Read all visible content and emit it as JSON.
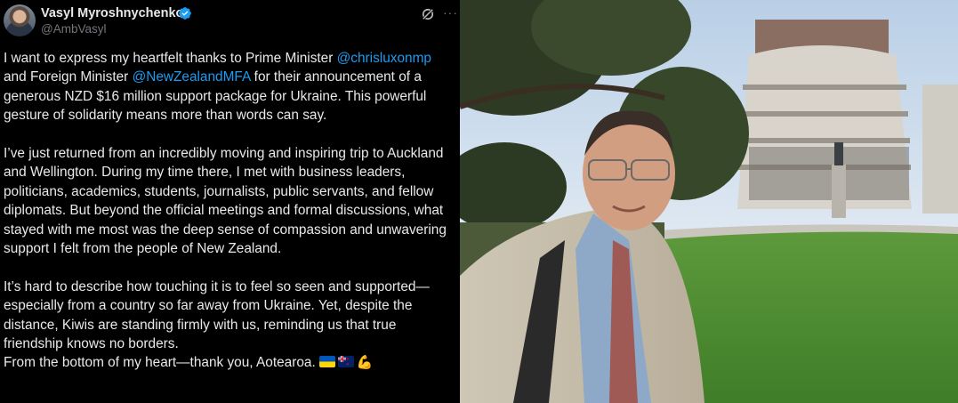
{
  "post": {
    "author_name": "Vasyl Myroshnychenko",
    "author_handle": "@AmbVasyl",
    "paragraphs": [
      {
        "parts": [
          {
            "text": "I want to express my heartfelt thanks to Prime Minister "
          },
          {
            "text": "@chrisluxonmp",
            "mention": true
          },
          {
            "text": " and Foreign Minister "
          },
          {
            "text": "@NewZealandMFA",
            "mention": true
          },
          {
            "text": " for their announcement of a generous NZD $16 million support package for Ukraine. This powerful gesture of solidarity means more than words can say."
          }
        ]
      },
      {
        "parts": [
          {
            "text": "I’ve just returned from an incredibly moving and inspiring trip to Auckland and Wellington. During my time there, I met with business leaders, politicians, academics, students, journalists, public servants, and fellow diplomats. But beyond the official meetings and formal discussions, what stayed with me most was the deep sense of compassion and unwavering support I felt from the people of New Zealand."
          }
        ]
      },
      {
        "parts": [
          {
            "text": "It’s hard to describe how touching it is to feel so seen and supported—especially from a country so far away from Ukraine. Yet, despite the distance, Kiwis are standing firmly with us, reminding us that true friendship knows no borders."
          }
        ],
        "last_line": "From the bottom of my heart—thank you, Aotearoa."
      }
    ],
    "emojis": [
      "flag-ukraine",
      "flag-new-zealand",
      "flexed-biceps"
    ],
    "accent_color": "#1d9bf0",
    "background": "#000000"
  }
}
